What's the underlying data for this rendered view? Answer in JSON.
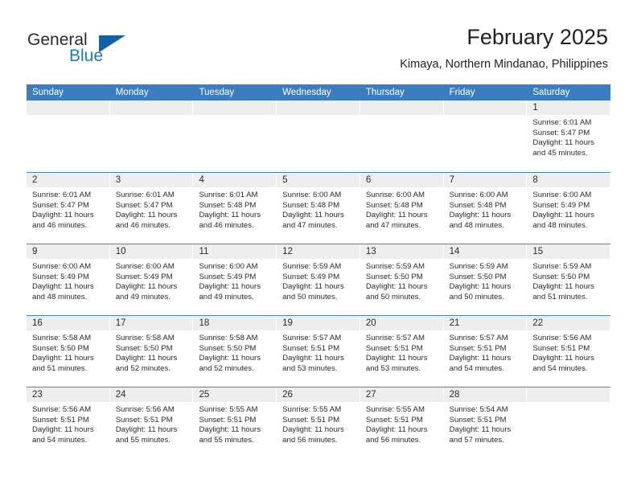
{
  "brand": {
    "name_part1": "General",
    "name_part2": "Blue",
    "accent_color": "#1a7ac4",
    "triangle_color": "#1160a8"
  },
  "header": {
    "title": "February 2025",
    "subtitle": "Kimaya, Northern Mindanao, Philippines"
  },
  "calendar": {
    "header_bg": "#3b7dc0",
    "daynum_bg": "#eeeeee",
    "row_border": "#4a86c5",
    "weekdays": [
      "Sunday",
      "Monday",
      "Tuesday",
      "Wednesday",
      "Thursday",
      "Friday",
      "Saturday"
    ],
    "weeks": [
      [
        {
          "day": "",
          "sunrise": "",
          "sunset": "",
          "daylight1": "",
          "daylight2": "",
          "blank": true
        },
        {
          "day": "",
          "sunrise": "",
          "sunset": "",
          "daylight1": "",
          "daylight2": "",
          "blank": true
        },
        {
          "day": "",
          "sunrise": "",
          "sunset": "",
          "daylight1": "",
          "daylight2": "",
          "blank": true
        },
        {
          "day": "",
          "sunrise": "",
          "sunset": "",
          "daylight1": "",
          "daylight2": "",
          "blank": true
        },
        {
          "day": "",
          "sunrise": "",
          "sunset": "",
          "daylight1": "",
          "daylight2": "",
          "blank": true
        },
        {
          "day": "",
          "sunrise": "",
          "sunset": "",
          "daylight1": "",
          "daylight2": "",
          "blank": true
        },
        {
          "day": "1",
          "sunrise": "Sunrise: 6:01 AM",
          "sunset": "Sunset: 5:47 PM",
          "daylight1": "Daylight: 11 hours",
          "daylight2": "and 45 minutes.",
          "blank": false
        }
      ],
      [
        {
          "day": "2",
          "sunrise": "Sunrise: 6:01 AM",
          "sunset": "Sunset: 5:47 PM",
          "daylight1": "Daylight: 11 hours",
          "daylight2": "and 46 minutes.",
          "blank": false
        },
        {
          "day": "3",
          "sunrise": "Sunrise: 6:01 AM",
          "sunset": "Sunset: 5:47 PM",
          "daylight1": "Daylight: 11 hours",
          "daylight2": "and 46 minutes.",
          "blank": false
        },
        {
          "day": "4",
          "sunrise": "Sunrise: 6:01 AM",
          "sunset": "Sunset: 5:48 PM",
          "daylight1": "Daylight: 11 hours",
          "daylight2": "and 46 minutes.",
          "blank": false
        },
        {
          "day": "5",
          "sunrise": "Sunrise: 6:00 AM",
          "sunset": "Sunset: 5:48 PM",
          "daylight1": "Daylight: 11 hours",
          "daylight2": "and 47 minutes.",
          "blank": false
        },
        {
          "day": "6",
          "sunrise": "Sunrise: 6:00 AM",
          "sunset": "Sunset: 5:48 PM",
          "daylight1": "Daylight: 11 hours",
          "daylight2": "and 47 minutes.",
          "blank": false
        },
        {
          "day": "7",
          "sunrise": "Sunrise: 6:00 AM",
          "sunset": "Sunset: 5:48 PM",
          "daylight1": "Daylight: 11 hours",
          "daylight2": "and 48 minutes.",
          "blank": false
        },
        {
          "day": "8",
          "sunrise": "Sunrise: 6:00 AM",
          "sunset": "Sunset: 5:49 PM",
          "daylight1": "Daylight: 11 hours",
          "daylight2": "and 48 minutes.",
          "blank": false
        }
      ],
      [
        {
          "day": "9",
          "sunrise": "Sunrise: 6:00 AM",
          "sunset": "Sunset: 5:49 PM",
          "daylight1": "Daylight: 11 hours",
          "daylight2": "and 48 minutes.",
          "blank": false
        },
        {
          "day": "10",
          "sunrise": "Sunrise: 6:00 AM",
          "sunset": "Sunset: 5:49 PM",
          "daylight1": "Daylight: 11 hours",
          "daylight2": "and 49 minutes.",
          "blank": false
        },
        {
          "day": "11",
          "sunrise": "Sunrise: 6:00 AM",
          "sunset": "Sunset: 5:49 PM",
          "daylight1": "Daylight: 11 hours",
          "daylight2": "and 49 minutes.",
          "blank": false
        },
        {
          "day": "12",
          "sunrise": "Sunrise: 5:59 AM",
          "sunset": "Sunset: 5:49 PM",
          "daylight1": "Daylight: 11 hours",
          "daylight2": "and 50 minutes.",
          "blank": false
        },
        {
          "day": "13",
          "sunrise": "Sunrise: 5:59 AM",
          "sunset": "Sunset: 5:50 PM",
          "daylight1": "Daylight: 11 hours",
          "daylight2": "and 50 minutes.",
          "blank": false
        },
        {
          "day": "14",
          "sunrise": "Sunrise: 5:59 AM",
          "sunset": "Sunset: 5:50 PM",
          "daylight1": "Daylight: 11 hours",
          "daylight2": "and 50 minutes.",
          "blank": false
        },
        {
          "day": "15",
          "sunrise": "Sunrise: 5:59 AM",
          "sunset": "Sunset: 5:50 PM",
          "daylight1": "Daylight: 11 hours",
          "daylight2": "and 51 minutes.",
          "blank": false
        }
      ],
      [
        {
          "day": "16",
          "sunrise": "Sunrise: 5:58 AM",
          "sunset": "Sunset: 5:50 PM",
          "daylight1": "Daylight: 11 hours",
          "daylight2": "and 51 minutes.",
          "blank": false
        },
        {
          "day": "17",
          "sunrise": "Sunrise: 5:58 AM",
          "sunset": "Sunset: 5:50 PM",
          "daylight1": "Daylight: 11 hours",
          "daylight2": "and 52 minutes.",
          "blank": false
        },
        {
          "day": "18",
          "sunrise": "Sunrise: 5:58 AM",
          "sunset": "Sunset: 5:50 PM",
          "daylight1": "Daylight: 11 hours",
          "daylight2": "and 52 minutes.",
          "blank": false
        },
        {
          "day": "19",
          "sunrise": "Sunrise: 5:57 AM",
          "sunset": "Sunset: 5:51 PM",
          "daylight1": "Daylight: 11 hours",
          "daylight2": "and 53 minutes.",
          "blank": false
        },
        {
          "day": "20",
          "sunrise": "Sunrise: 5:57 AM",
          "sunset": "Sunset: 5:51 PM",
          "daylight1": "Daylight: 11 hours",
          "daylight2": "and 53 minutes.",
          "blank": false
        },
        {
          "day": "21",
          "sunrise": "Sunrise: 5:57 AM",
          "sunset": "Sunset: 5:51 PM",
          "daylight1": "Daylight: 11 hours",
          "daylight2": "and 54 minutes.",
          "blank": false
        },
        {
          "day": "22",
          "sunrise": "Sunrise: 5:56 AM",
          "sunset": "Sunset: 5:51 PM",
          "daylight1": "Daylight: 11 hours",
          "daylight2": "and 54 minutes.",
          "blank": false
        }
      ],
      [
        {
          "day": "23",
          "sunrise": "Sunrise: 5:56 AM",
          "sunset": "Sunset: 5:51 PM",
          "daylight1": "Daylight: 11 hours",
          "daylight2": "and 54 minutes.",
          "blank": false
        },
        {
          "day": "24",
          "sunrise": "Sunrise: 5:56 AM",
          "sunset": "Sunset: 5:51 PM",
          "daylight1": "Daylight: 11 hours",
          "daylight2": "and 55 minutes.",
          "blank": false
        },
        {
          "day": "25",
          "sunrise": "Sunrise: 5:55 AM",
          "sunset": "Sunset: 5:51 PM",
          "daylight1": "Daylight: 11 hours",
          "daylight2": "and 55 minutes.",
          "blank": false
        },
        {
          "day": "26",
          "sunrise": "Sunrise: 5:55 AM",
          "sunset": "Sunset: 5:51 PM",
          "daylight1": "Daylight: 11 hours",
          "daylight2": "and 56 minutes.",
          "blank": false
        },
        {
          "day": "27",
          "sunrise": "Sunrise: 5:55 AM",
          "sunset": "Sunset: 5:51 PM",
          "daylight1": "Daylight: 11 hours",
          "daylight2": "and 56 minutes.",
          "blank": false
        },
        {
          "day": "28",
          "sunrise": "Sunrise: 5:54 AM",
          "sunset": "Sunset: 5:51 PM",
          "daylight1": "Daylight: 11 hours",
          "daylight2": "and 57 minutes.",
          "blank": false
        },
        {
          "day": "",
          "sunrise": "",
          "sunset": "",
          "daylight1": "",
          "daylight2": "",
          "blank": true
        }
      ]
    ]
  }
}
